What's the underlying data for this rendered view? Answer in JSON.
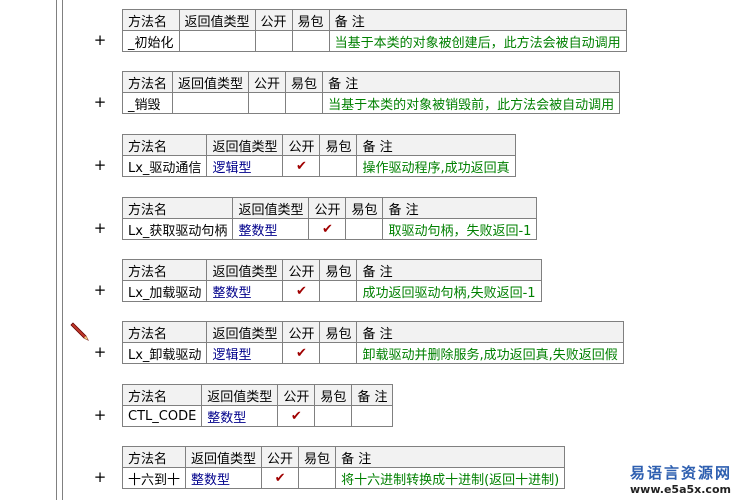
{
  "headers": {
    "name": "方法名",
    "return_type": "返回值类型",
    "public": "公开",
    "easy_pack": "易包",
    "note": "备 注"
  },
  "expand_symbol": "+",
  "check_symbol": "✔",
  "methods": [
    {
      "name": "_初始化",
      "return_type": "",
      "public": false,
      "note": "当基于本类的对象被创建后，此方法会被自动调用"
    },
    {
      "name": "_销毁",
      "return_type": "",
      "public": false,
      "note": "当基于本类的对象被销毁前，此方法会被自动调用"
    },
    {
      "name": "Lx_驱动通信",
      "return_type": "逻辑型",
      "public": true,
      "note": "操作驱动程序,成功返回真"
    },
    {
      "name": "Lx_获取驱动句柄",
      "return_type": "整数型",
      "public": true,
      "note": "取驱动句柄，失败返回-1"
    },
    {
      "name": "Lx_加载驱动",
      "return_type": "整数型",
      "public": true,
      "note": "成功返回驱动句柄,失败返回-1"
    },
    {
      "name": "Lx_卸载驱动",
      "return_type": "逻辑型",
      "public": true,
      "note": "卸载驱动并删除服务,成功返回真,失败返回假"
    },
    {
      "name": "CTL_CODE",
      "return_type": "整数型",
      "public": true,
      "note": ""
    },
    {
      "name": "十六到十",
      "return_type": "整数型",
      "public": true,
      "note": "将十六进制转换成十进制(返回十进制)"
    }
  ],
  "watermark": {
    "text": "易语言资源网",
    "url": "www.e5a5x.com"
  },
  "colors": {
    "type_text": "#00008b",
    "note_text": "#008000",
    "check": "#a00000"
  }
}
